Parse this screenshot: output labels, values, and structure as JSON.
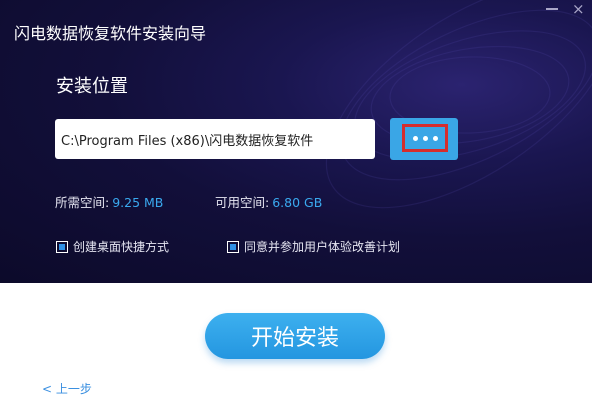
{
  "window": {
    "title": "闪电数据恢复软件安装向导",
    "minimize_icon": "minimize-icon",
    "close_icon": "close-icon",
    "close_glyph": "×"
  },
  "install": {
    "section_label": "安装位置",
    "path_value": "C:\\Program Files (x86)\\闪电数据恢复软件",
    "browse_icon": "ellipsis-icon"
  },
  "space": {
    "required_label": "所需空间:",
    "required_value": "9.25 MB",
    "available_label": "可用空间:",
    "available_value": "6.80 GB"
  },
  "options": {
    "desktop_shortcut": {
      "label": "创建桌面快捷方式",
      "checked": true
    },
    "ux_program": {
      "label": "同意并参加用户体验改善计划",
      "checked": true
    }
  },
  "actions": {
    "start_label": "开始安装",
    "back_label": "< 上一步"
  },
  "colors": {
    "header_bg": "#120f3a",
    "accent": "#3aa6e6",
    "highlight_border": "#d62d2d",
    "link": "#3a8fe0"
  }
}
